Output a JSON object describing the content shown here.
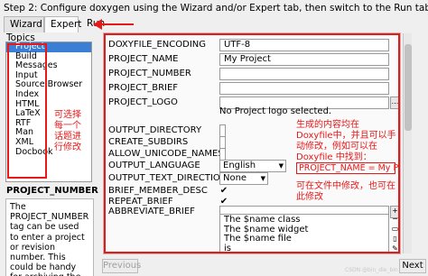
{
  "header": {
    "instruction": "Step 2: Configure doxygen using the Wizard and/or Expert tab, then switch to the Run tab to generate the documentation"
  },
  "tabs": [
    {
      "label": "Wizard"
    },
    {
      "label": "Expert"
    },
    {
      "label": "Run"
    }
  ],
  "sidebar": {
    "topics_label": "Topics",
    "items": [
      "Project",
      "Build",
      "Messages",
      "Input",
      "Source Browser",
      "Index",
      "HTML",
      "LaTeX",
      "RTF",
      "Man",
      "XML",
      "Docbook"
    ],
    "selected": "Project",
    "annotation": "可选择每一个话题进行修改"
  },
  "help": {
    "title": "PROJECT_NUMBER",
    "text": "The PROJECT_NUMBER tag can be used to enter a project or revision number. This could be handy for archiving the generated documentation or if some version control system is"
  },
  "settings": [
    {
      "name": "DOXYFILE_ENCODING",
      "value": "UTF-8"
    },
    {
      "name": "PROJECT_NAME",
      "value": "My Project"
    },
    {
      "name": "PROJECT_NUMBER",
      "value": ""
    },
    {
      "name": "PROJECT_BRIEF",
      "value": ""
    },
    {
      "name": "PROJECT_LOGO",
      "value": ""
    },
    {
      "name": "OUTPUT_DIRECTORY",
      "value": ""
    },
    {
      "name": "CREATE_SUBDIRS",
      "value": ""
    },
    {
      "name": "ALLOW_UNICODE_NAMES",
      "value": ""
    },
    {
      "name": "OUTPUT_LANGUAGE",
      "value": "English"
    },
    {
      "name": "OUTPUT_TEXT_DIRECTION",
      "value": "None"
    },
    {
      "name": "BRIEF_MEMBER_DESC",
      "value": "✔"
    },
    {
      "name": "REPEAT_BRIEF",
      "value": "✔"
    },
    {
      "name": "ABBREVIATE_BRIEF",
      "value": ""
    }
  ],
  "logo_note": "No Project logo selected.",
  "dot_button_label": "...",
  "abbreviate_list": [
    "The $name class",
    "The $name widget",
    "The $name file",
    "is"
  ],
  "annotations": {
    "right_top": "生成的内容均在 Doxyfile中，并且可以手动修改，例如可以在 Doxyfile 中找到：",
    "example": "PROJECT_NAME = My Project",
    "right_bottom": "可在文件中修改，也可在此修改"
  },
  "footer": {
    "previous": "Previous",
    "next": "Next",
    "watermark": "CSDN @bin_die_bin"
  },
  "colors": {
    "annotation_red": "#e81818",
    "selection_blue": "#3a7fd5"
  }
}
